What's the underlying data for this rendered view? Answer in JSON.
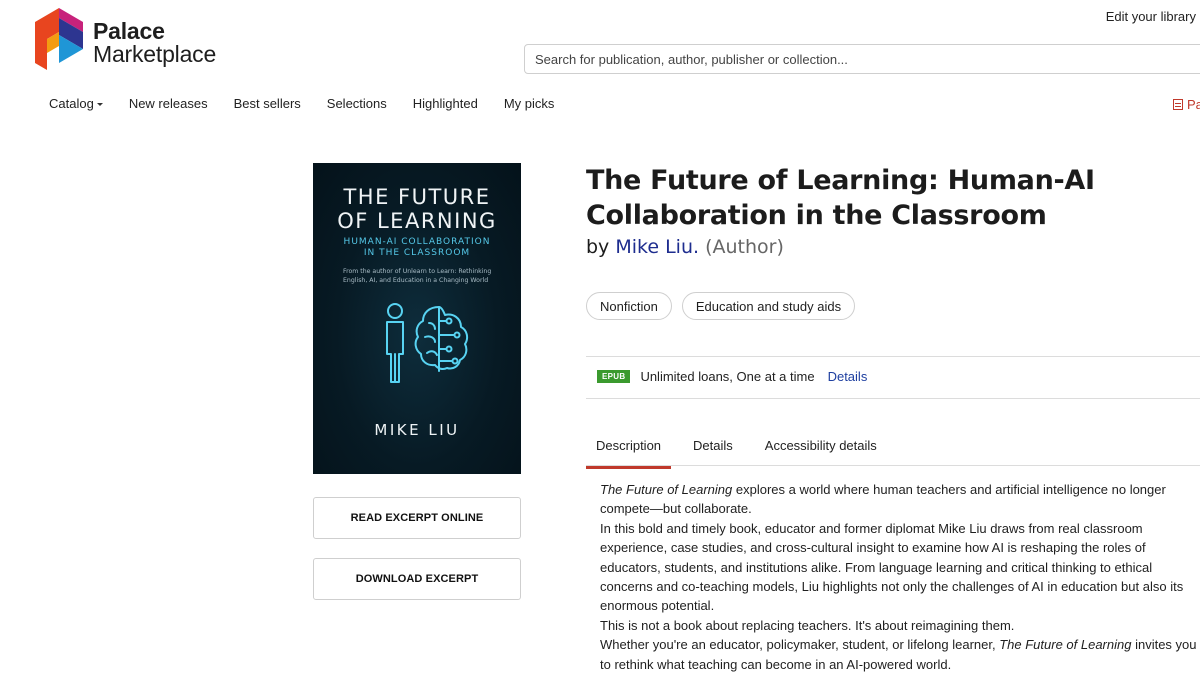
{
  "header": {
    "logo_line1": "Palace",
    "logo_line2": "Marketplace",
    "edit_library": "Edit your library",
    "search_placeholder": "Search for publication, author, publisher or collection..."
  },
  "nav": {
    "items": [
      "Catalog",
      "New releases",
      "Best sellers",
      "Selections",
      "Highlighted",
      "My picks"
    ],
    "right_label": "Pa"
  },
  "cover": {
    "title_line1": "THE FUTURE",
    "title_line2": "OF LEARNING",
    "subtitle_line1": "HUMAN-AI COLLABORATION",
    "subtitle_line2": "IN THE CLASSROOM",
    "tagline": "From the author of Unlearn to Learn: Rethinking English, AI, and Education in a Changing World",
    "author": "MIKE LIU"
  },
  "buttons": {
    "read_excerpt": "READ EXCERPT ONLINE",
    "download_excerpt": "DOWNLOAD EXCERPT"
  },
  "book": {
    "title": "The Future of Learning: Human-AI Collaboration in the Classroom",
    "by": "by",
    "author": "Mike Liu.",
    "role": "(Author)",
    "tags": [
      "Nonfiction",
      "Education and study aids"
    ],
    "format_badge": "EPUB",
    "format_text": "Unlimited loans, One at a time",
    "format_link": "Details"
  },
  "tabs": [
    "Description",
    "Details",
    "Accessibility details"
  ],
  "description": {
    "p1_title": "The Future of Learning",
    "p1_rest": " explores a world where human teachers and artificial intelligence no longer compete—but collaborate.",
    "p2": "In this bold and timely book, educator and former diplomat Mike Liu draws from real classroom experience, case studies, and cross-cultural insight to examine how AI is reshaping the roles of educators, students, and institutions alike. From language learning and critical thinking to ethical concerns and co-teaching models, Liu highlights not only the challenges of AI in education but also its enormous potential.",
    "p3": "This is not a book about replacing teachers. It's about reimagining them.",
    "p4_start": "Whether you're an educator, policymaker, student, or lifelong learner, ",
    "p4_title": "The Future of Learning",
    "p4_end": " invites you to rethink what teaching can become in an AI-powered world."
  }
}
